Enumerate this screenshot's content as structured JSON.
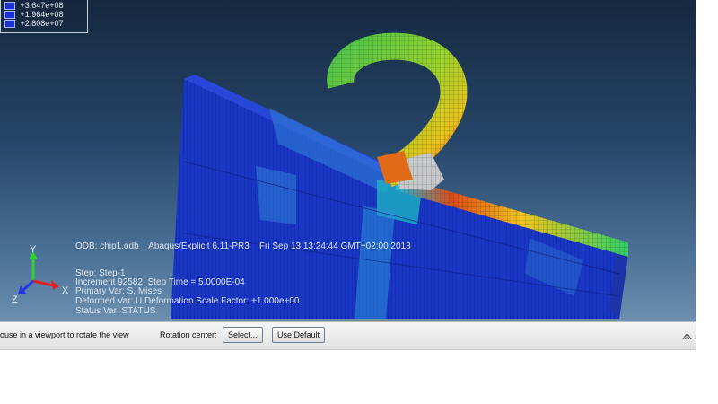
{
  "legend": {
    "values": [
      "+3.647e+08",
      "+1.964e+08",
      "+2.808e+07"
    ]
  },
  "info": {
    "odb": "ODB: chip1.odb",
    "product": "Abaqus/Explicit 6.11-PR3",
    "datetime": "Fri Sep 13 13:24:44 GMT+02:00 2013",
    "step": "Step: Step-1",
    "increment": "Increment     92582: Step Time =    5.0000E-04",
    "primary_var": "Primary Var: S, Mises",
    "deformed_var": "Deformed Var: U   Deformation Scale Factor: +1.000e+00",
    "status_var": "Status Var: STATUS"
  },
  "triad": {
    "x": "X",
    "y": "Y",
    "z": "Z"
  },
  "statusbar": {
    "hint": "ouse in a viewport to rotate the view",
    "rotation_label": "Rotation center:",
    "select_btn": "Select...",
    "default_btn": "Use Default"
  },
  "colors": {
    "mesh_blue": "#1b3ccf",
    "hot": "#e8451a",
    "warm": "#f2c21c",
    "mid": "#2fd47a",
    "background_top": "#15293f",
    "background_bottom": "#6d8fb0"
  }
}
